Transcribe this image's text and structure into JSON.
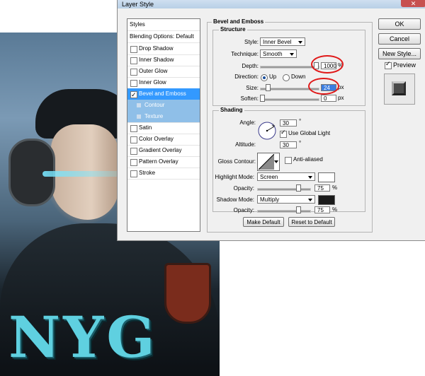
{
  "window": {
    "title": "Layer Style",
    "close_glyph": "✕"
  },
  "poster_text": "NYG",
  "styles_list": {
    "header": "Styles",
    "blending": "Blending Options: Default",
    "items": [
      {
        "label": "Drop Shadow",
        "checked": false
      },
      {
        "label": "Inner Shadow",
        "checked": false
      },
      {
        "label": "Outer Glow",
        "checked": false
      },
      {
        "label": "Inner Glow",
        "checked": false
      },
      {
        "label": "Bevel and Emboss",
        "checked": true,
        "selected": true
      },
      {
        "label": "Contour",
        "sub": true
      },
      {
        "label": "Texture",
        "sub": true
      },
      {
        "label": "Satin",
        "checked": false
      },
      {
        "label": "Color Overlay",
        "checked": false
      },
      {
        "label": "Gradient Overlay",
        "checked": false
      },
      {
        "label": "Pattern Overlay",
        "checked": false
      },
      {
        "label": "Stroke",
        "checked": false
      }
    ]
  },
  "bevel": {
    "section_title": "Bevel and Emboss",
    "structure": {
      "title": "Structure",
      "style_label": "Style:",
      "style_value": "Inner Bevel",
      "technique_label": "Technique:",
      "technique_value": "Smooth",
      "depth_label": "Depth:",
      "depth_value": "1000",
      "depth_unit": "%",
      "direction_label": "Direction:",
      "direction_up": "Up",
      "direction_down": "Down",
      "size_label": "Size:",
      "size_value": "24",
      "size_unit": "px",
      "soften_label": "Soften:",
      "soften_value": "0",
      "soften_unit": "px"
    },
    "shading": {
      "title": "Shading",
      "angle_label": "Angle:",
      "angle_value": "30",
      "angle_unit": "°",
      "global_light_label": "Use Global Light",
      "altitude_label": "Altitude:",
      "altitude_value": "30",
      "altitude_unit": "°",
      "gloss_label": "Gloss Contour:",
      "anti_aliased_label": "Anti-aliased",
      "highlight_mode_label": "Highlight Mode:",
      "highlight_mode_value": "Screen",
      "highlight_opacity_label": "Opacity:",
      "highlight_opacity_value": "75",
      "highlight_opacity_unit": "%",
      "shadow_mode_label": "Shadow Mode:",
      "shadow_mode_value": "Multiply",
      "shadow_opacity_label": "Opacity:",
      "shadow_opacity_value": "75",
      "shadow_opacity_unit": "%"
    },
    "make_default": "Make Default",
    "reset_default": "Reset to Default"
  },
  "buttons": {
    "ok": "OK",
    "cancel": "Cancel",
    "new_style": "New Style...",
    "preview": "Preview"
  },
  "colors": {
    "highlight": "#ffffff",
    "shadow": "#1a1a1a",
    "selected": "#3399ff",
    "annotation": "#e01818"
  }
}
